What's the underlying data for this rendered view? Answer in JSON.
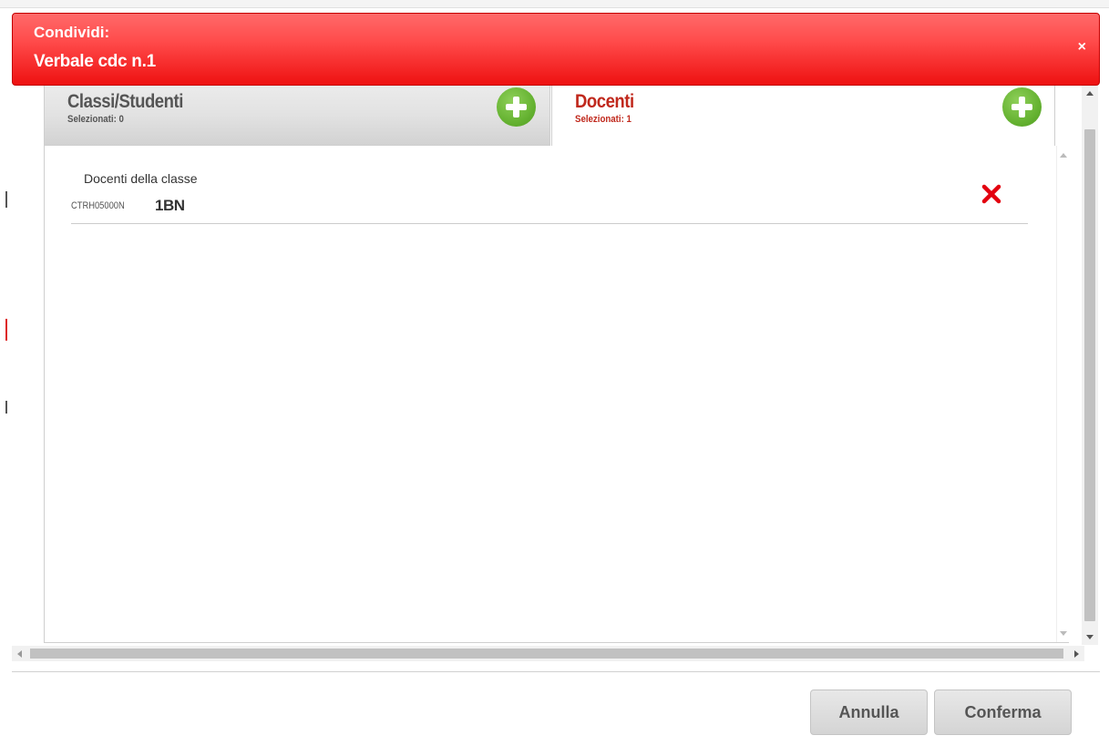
{
  "dialog": {
    "title_small": "Condividi:",
    "title_big": "Verbale cdc n.1",
    "close_label": "×"
  },
  "tabs": [
    {
      "title": "Classi/Studenti",
      "subtitle": "Selezionati: 0",
      "active": false
    },
    {
      "title": "Docenti",
      "subtitle": "Selezionati: 1",
      "active": true
    }
  ],
  "list": {
    "items": [
      {
        "label": "Docenti della classe",
        "code": "CTRH05000N",
        "class_name": "1BN"
      }
    ]
  },
  "footer": {
    "cancel_label": "Annulla",
    "confirm_label": "Conferma"
  },
  "colors": {
    "header_red": "#ee1111",
    "active_tab_text": "#c0281c",
    "add_green": "#66b332",
    "remove_red": "#e3000f"
  },
  "icons": {
    "add": "plus-circle-icon",
    "remove": "x-icon",
    "close": "close-icon"
  }
}
